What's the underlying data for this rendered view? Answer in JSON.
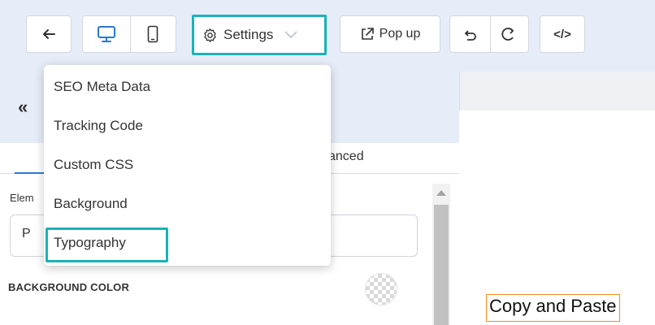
{
  "toolbar": {
    "back_icon": "arrow-left-icon",
    "desktop_icon": "desktop-monitor-icon",
    "mobile_icon": "mobile-phone-icon",
    "settings_label": "Settings",
    "settings_icon": "gear-icon",
    "popup_label": "Pop up",
    "popup_icon": "external-link-icon",
    "undo_icon": "undo-icon",
    "redo_icon": "redo-icon",
    "code_label": "</>",
    "active_color": "#2b79d6"
  },
  "settings_menu": {
    "items": [
      "SEO Meta Data",
      "Tracking Code",
      "Custom CSS",
      "Background",
      "Typography"
    ],
    "highlighted_item": "Typography",
    "highlight_color": "#19b3b5"
  },
  "left_panel": {
    "collapse_label": "«",
    "tab_advanced_visible_text": "vanced",
    "element_label_visible": "Elem",
    "element_input_visible": "P",
    "background_color_label": "BACKGROUND COLOR"
  },
  "canvas": {
    "text": "Copy and Paste"
  }
}
